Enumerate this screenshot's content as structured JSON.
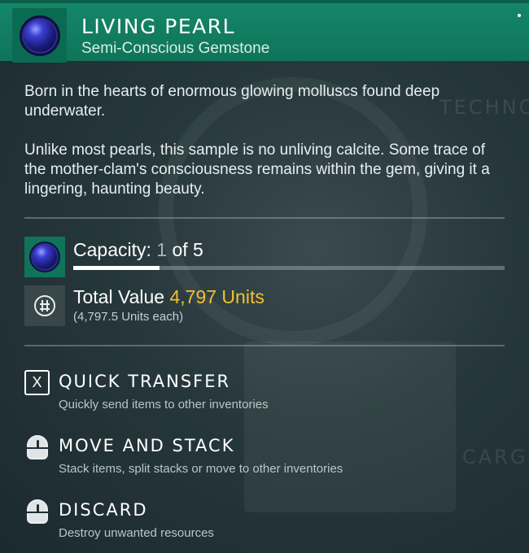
{
  "item": {
    "title": "LIVING PEARL",
    "subtitle": "Semi-Conscious Gemstone",
    "icon": "living-pearl-icon"
  },
  "description": {
    "paragraph_1": "Born in the hearts of enormous glowing molluscs found deep underwater.",
    "paragraph_2": "Unlike most pearls, this sample is no unliving calcite. Some trace of the mother-clam's consciousness remains within the gem, giving it a lingering, haunting beauty."
  },
  "capacity": {
    "label": "Capacity:",
    "current": "1",
    "of_text": "of 5",
    "fill_fraction": 0.2
  },
  "value": {
    "label": "Total Value",
    "amount": "4,797 Units",
    "each": "(4,797.5 Units each)",
    "icon": "units-currency-icon"
  },
  "actions": [
    {
      "key": "X",
      "title": "QUICK TRANSFER",
      "desc": "Quickly send items to other inventories",
      "icon": "x-key-icon"
    },
    {
      "key": "",
      "title": "MOVE AND STACK",
      "desc": "Stack items, split stacks or move to other inventories",
      "icon": "mouse-button-icon"
    },
    {
      "key": "",
      "title": "DISCARD",
      "desc": "Destroy unwanted resources",
      "icon": "mouse-button-icon"
    }
  ],
  "background_text": {
    "label_1": "TECHNOL",
    "label_2": "CARGO"
  },
  "colors": {
    "header": "#14866a",
    "value_gold": "#f2c12e",
    "background": "#26373b"
  }
}
